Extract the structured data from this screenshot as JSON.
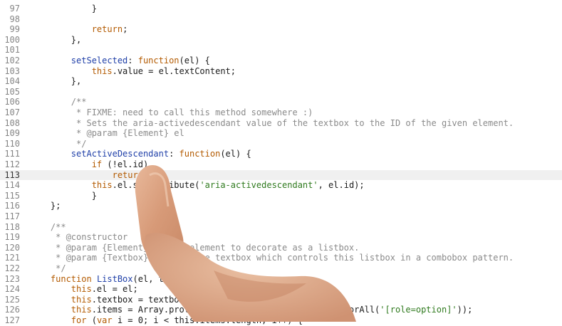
{
  "editor": {
    "active_line": "113",
    "lines": [
      {
        "num": "97",
        "indent": "            ",
        "tokens": [
          {
            "t": "}",
            "c": "pl"
          }
        ]
      },
      {
        "num": "98",
        "indent": "",
        "tokens": []
      },
      {
        "num": "99",
        "indent": "            ",
        "tokens": [
          {
            "t": "return",
            "c": "kw"
          },
          {
            "t": ";",
            "c": "pl"
          }
        ]
      },
      {
        "num": "100",
        "indent": "        ",
        "tokens": [
          {
            "t": "},",
            "c": "pl"
          }
        ]
      },
      {
        "num": "101",
        "indent": "",
        "tokens": []
      },
      {
        "num": "102",
        "indent": "        ",
        "tokens": [
          {
            "t": "setSelected",
            "c": "fn"
          },
          {
            "t": ": ",
            "c": "pl"
          },
          {
            "t": "function",
            "c": "kw"
          },
          {
            "t": "(el) {",
            "c": "pl"
          }
        ]
      },
      {
        "num": "103",
        "indent": "            ",
        "tokens": [
          {
            "t": "this",
            "c": "kw"
          },
          {
            "t": ".value = el.textContent;",
            "c": "pl"
          }
        ]
      },
      {
        "num": "104",
        "indent": "        ",
        "tokens": [
          {
            "t": "},",
            "c": "pl"
          }
        ]
      },
      {
        "num": "105",
        "indent": "",
        "tokens": []
      },
      {
        "num": "106",
        "indent": "        ",
        "tokens": [
          {
            "t": "/**",
            "c": "cm"
          }
        ]
      },
      {
        "num": "107",
        "indent": "         ",
        "tokens": [
          {
            "t": "* FIXME: need to call this method somewhere :)",
            "c": "cm"
          }
        ]
      },
      {
        "num": "108",
        "indent": "         ",
        "tokens": [
          {
            "t": "* Sets the aria-activedescendant value of the textbox to the ID of the given element.",
            "c": "cm"
          }
        ]
      },
      {
        "num": "109",
        "indent": "         ",
        "tokens": [
          {
            "t": "* @param {Element} el",
            "c": "cm"
          }
        ]
      },
      {
        "num": "110",
        "indent": "         ",
        "tokens": [
          {
            "t": "*/",
            "c": "cm"
          }
        ]
      },
      {
        "num": "111",
        "indent": "        ",
        "tokens": [
          {
            "t": "setActiveDescendant",
            "c": "fn"
          },
          {
            "t": ": ",
            "c": "pl"
          },
          {
            "t": "function",
            "c": "kw"
          },
          {
            "t": "(el) {",
            "c": "pl"
          }
        ]
      },
      {
        "num": "112",
        "indent": "            ",
        "tokens": [
          {
            "t": "if",
            "c": "kw"
          },
          {
            "t": " (!el.id)",
            "c": "pl"
          }
        ]
      },
      {
        "num": "113",
        "indent": "                ",
        "tokens": [
          {
            "t": "return",
            "c": "kw"
          },
          {
            "t": ";",
            "c": "pl"
          }
        ]
      },
      {
        "num": "114",
        "indent": "            ",
        "tokens": [
          {
            "t": "this",
            "c": "kw"
          },
          {
            "t": ".el.setAttribute(",
            "c": "pl"
          },
          {
            "t": "'aria-activedescendant'",
            "c": "str"
          },
          {
            "t": ", el.id);",
            "c": "pl"
          }
        ]
      },
      {
        "num": "115",
        "indent": "            ",
        "tokens": [
          {
            "t": "}",
            "c": "pl"
          }
        ]
      },
      {
        "num": "116",
        "indent": "    ",
        "tokens": [
          {
            "t": "};",
            "c": "pl"
          }
        ]
      },
      {
        "num": "117",
        "indent": "",
        "tokens": []
      },
      {
        "num": "118",
        "indent": "    ",
        "tokens": [
          {
            "t": "/**",
            "c": "cm"
          }
        ]
      },
      {
        "num": "119",
        "indent": "     ",
        "tokens": [
          {
            "t": "* @constructor",
            "c": "cm"
          }
        ]
      },
      {
        "num": "120",
        "indent": "     ",
        "tokens": [
          {
            "t": "* @param {Element} el The element to decorate as a listbox.",
            "c": "cm"
          }
        ]
      },
      {
        "num": "121",
        "indent": "     ",
        "tokens": [
          {
            "t": "* @param {Textbox} textbox The textbox which controls this listbox in a combobox pattern.",
            "c": "cm"
          }
        ]
      },
      {
        "num": "122",
        "indent": "     ",
        "tokens": [
          {
            "t": "*/",
            "c": "cm"
          }
        ]
      },
      {
        "num": "123",
        "indent": "    ",
        "tokens": [
          {
            "t": "function",
            "c": "kw"
          },
          {
            "t": " ",
            "c": "pl"
          },
          {
            "t": "ListBox",
            "c": "fn"
          },
          {
            "t": "(el, textbox) {",
            "c": "pl"
          }
        ]
      },
      {
        "num": "124",
        "indent": "        ",
        "tokens": [
          {
            "t": "this",
            "c": "kw"
          },
          {
            "t": ".el = el;",
            "c": "pl"
          }
        ]
      },
      {
        "num": "125",
        "indent": "        ",
        "tokens": [
          {
            "t": "this",
            "c": "kw"
          },
          {
            "t": ".textbox = textbox;",
            "c": "pl"
          }
        ]
      },
      {
        "num": "126",
        "indent": "        ",
        "tokens": [
          {
            "t": "this",
            "c": "kw"
          },
          {
            "t": ".items = Array.prototype.slice.call(el.querySelectorAll(",
            "c": "pl"
          },
          {
            "t": "'[role=option]'",
            "c": "str"
          },
          {
            "t": "));",
            "c": "pl"
          }
        ]
      },
      {
        "num": "127",
        "indent": "        ",
        "tokens": [
          {
            "t": "for",
            "c": "kw"
          },
          {
            "t": " (",
            "c": "pl"
          },
          {
            "t": "var",
            "c": "kw"
          },
          {
            "t": " i = 0; i < this.items.length; i++) {",
            "c": "pl"
          }
        ]
      }
    ]
  },
  "colors": {
    "keyword": "#b35a00",
    "function": "#1f3fa8",
    "string": "#2f7a1e",
    "comment": "#8a8a8a",
    "line_number": "#858585",
    "active_line_bg": "#f0f0f0"
  }
}
